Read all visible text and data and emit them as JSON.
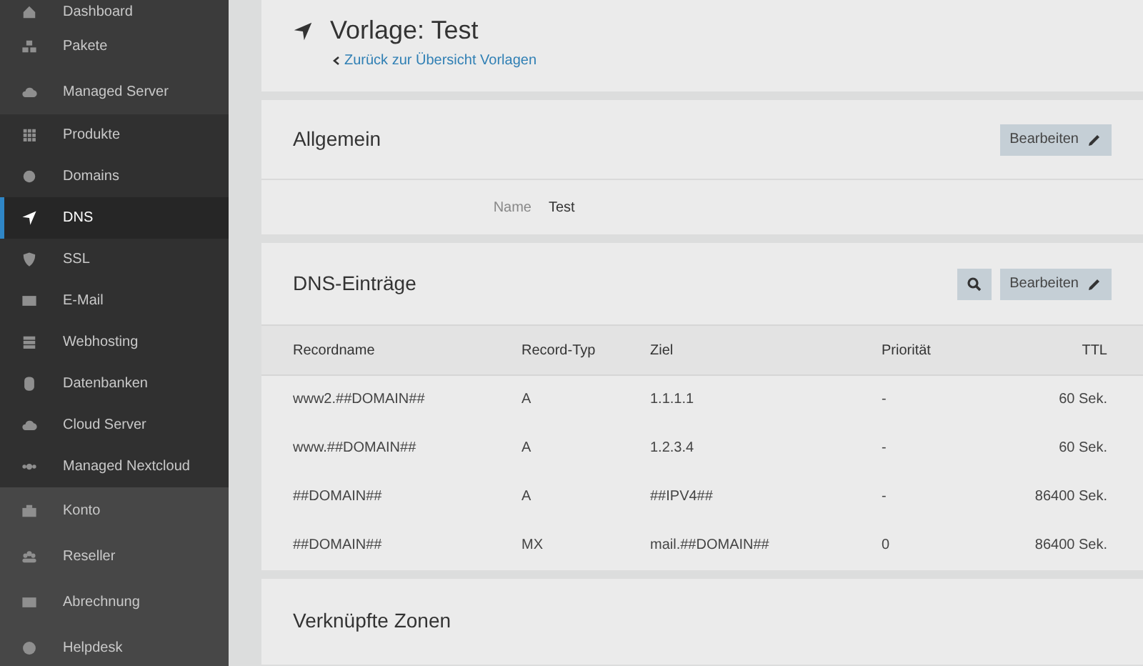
{
  "sidebar": {
    "groups": [
      {
        "items": [
          {
            "label": "Dashboard",
            "selected": false
          },
          {
            "label": "Pakete",
            "selected": false
          },
          {
            "label": "Managed Server",
            "selected": false
          }
        ]
      },
      {
        "items": [
          {
            "label": "Produkte",
            "selected": false
          },
          {
            "label": "Domains",
            "selected": false
          },
          {
            "label": "DNS",
            "selected": true
          },
          {
            "label": "SSL",
            "selected": false
          },
          {
            "label": "E-Mail",
            "selected": false
          },
          {
            "label": "Webhosting",
            "selected": false
          },
          {
            "label": "Datenbanken",
            "selected": false
          },
          {
            "label": "Cloud Server",
            "selected": false
          },
          {
            "label": "Managed Nextcloud",
            "selected": false
          }
        ]
      },
      {
        "items": [
          {
            "label": "Konto",
            "selected": false
          },
          {
            "label": "Reseller",
            "selected": false
          },
          {
            "label": "Abrechnung",
            "selected": false
          },
          {
            "label": "Helpdesk",
            "selected": false
          }
        ]
      }
    ]
  },
  "header": {
    "title": "Vorlage: Test",
    "back_link": "Zurück zur Übersicht Vorlagen"
  },
  "general": {
    "title": "Allgemein",
    "edit_button": "Bearbeiten",
    "fields": [
      {
        "label": "Name",
        "value": "Test"
      }
    ]
  },
  "dns": {
    "title": "DNS-Einträge",
    "edit_button": "Bearbeiten",
    "columns": [
      "Recordname",
      "Record-Typ",
      "Ziel",
      "Priorität",
      "TTL"
    ],
    "rows": [
      [
        "www2.##DOMAIN##",
        "A",
        "1.1.1.1",
        "-",
        "60 Sek."
      ],
      [
        "www.##DOMAIN##",
        "A",
        "1.2.3.4",
        "-",
        "60 Sek."
      ],
      [
        "##DOMAIN##",
        "A",
        "##IPV4##",
        "-",
        "86400 Sek."
      ],
      [
        "##DOMAIN##",
        "MX",
        "mail.##DOMAIN##",
        "0",
        "86400 Sek."
      ]
    ]
  },
  "zones": {
    "title": "Verknüpfte Zonen"
  }
}
